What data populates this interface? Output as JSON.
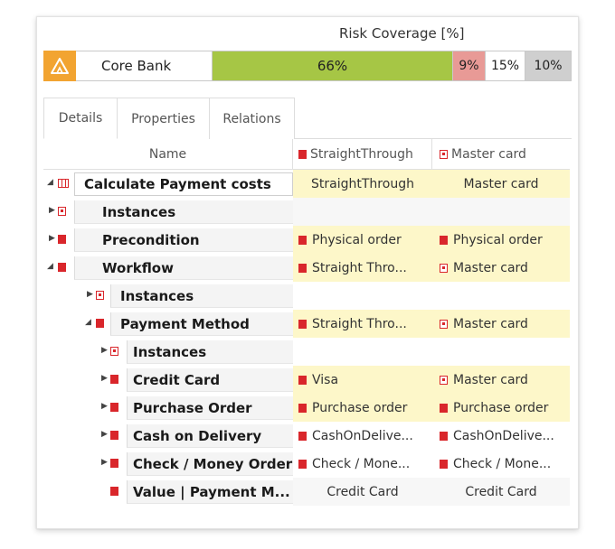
{
  "coverage": {
    "title": "Risk Coverage [%]",
    "name": "Core Bank",
    "segments": [
      {
        "label": "66%",
        "value": 66,
        "color": "#a6c645"
      },
      {
        "label": "9%",
        "value": 9,
        "color": "#e89a96"
      },
      {
        "label": "15%",
        "value": 15,
        "color": "#ffffff"
      },
      {
        "label": "10%",
        "value": 10,
        "color": "#cfcfcf"
      }
    ],
    "logo_icon": "warning-triangle-icon",
    "logo_color": "#f2a431"
  },
  "tabs": [
    {
      "label": "Details",
      "active": true
    },
    {
      "label": "Properties",
      "active": false
    },
    {
      "label": "Relations",
      "active": false
    }
  ],
  "table": {
    "headers": {
      "name": "Name",
      "col1": "StraightThrough",
      "col2": "Master card"
    },
    "rows": [
      {
        "label": "Calculate Payment costs",
        "c1": "StraightThrough",
        "c2": "Master card"
      },
      {
        "label": "Instances",
        "c1": "",
        "c2": ""
      },
      {
        "label": "Precondition",
        "c1": "Physical order",
        "c2": "Physical order"
      },
      {
        "label": "Workflow",
        "c1": "Straight Thro...",
        "c2": "Master card"
      },
      {
        "label": "Instances",
        "c1": "",
        "c2": ""
      },
      {
        "label": "Payment Method",
        "c1": "Straight Thro...",
        "c2": "Master card"
      },
      {
        "label": "Instances",
        "c1": "",
        "c2": ""
      },
      {
        "label": "Credit Card",
        "c1": "Visa",
        "c2": "Master card"
      },
      {
        "label": "Purchase Order",
        "c1": "Purchase order",
        "c2": "Purchase order"
      },
      {
        "label": "Cash on Delivery",
        "c1": "CashOnDelive...",
        "c2": "CashOnDelive..."
      },
      {
        "label": "Check / Money Order",
        "c1": "Check / Mone...",
        "c2": "Check / Mone..."
      },
      {
        "label": "Value | Payment M...",
        "c1": "Credit Card",
        "c2": "Credit Card"
      }
    ]
  },
  "colors": {
    "accent_red": "#d9262b",
    "highlight_yellow": "#fdf7c9"
  }
}
